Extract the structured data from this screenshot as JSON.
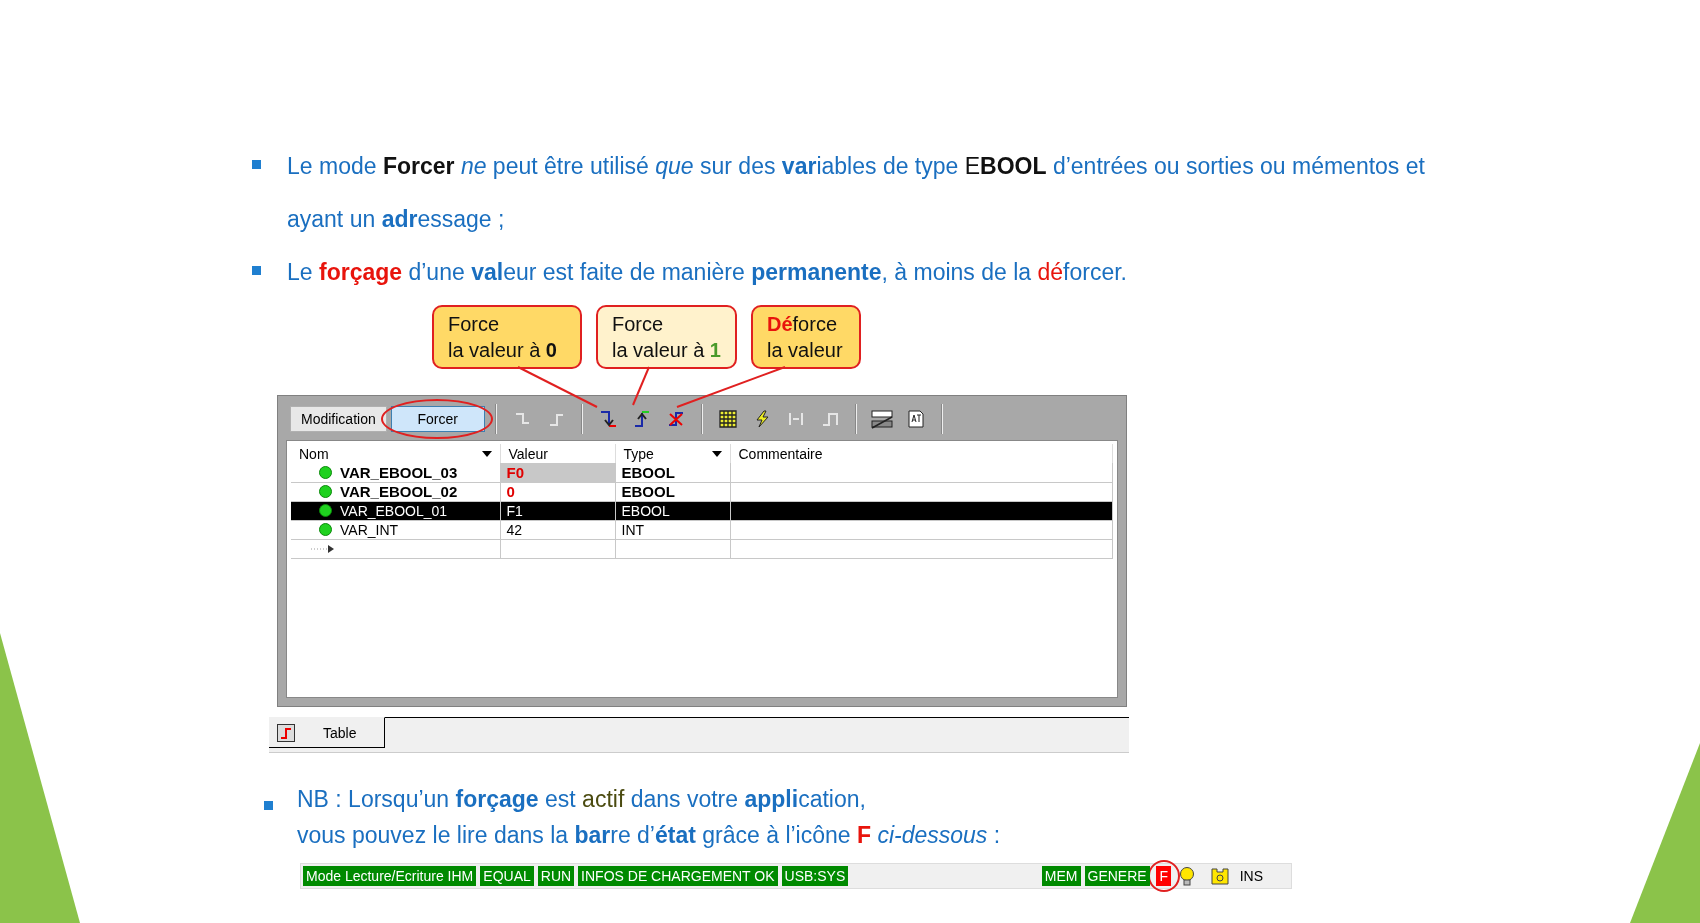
{
  "bullets": [
    {
      "lines": [
        [
          {
            "t": "Le mode "
          },
          {
            "t": "Forcer",
            "bold": true,
            "color": "#111111"
          },
          {
            "t": " ne",
            "italic": true
          },
          {
            "t": " peut être utilisé "
          },
          {
            "t": "que",
            "italic": true
          },
          {
            "t": " sur des "
          },
          {
            "t": "var",
            "bold": true
          },
          {
            "t": "iables de type "
          },
          {
            "t": "E",
            "color": "#111111"
          },
          {
            "t": "BOOL",
            "bold": true,
            "color": "#111111"
          },
          {
            "t": " d’entrées ou sorties ou mémentos et"
          }
        ],
        [
          {
            "t": "ayant un "
          },
          {
            "t": "adr",
            "bold": true
          },
          {
            "t": "essage ;"
          }
        ]
      ]
    },
    {
      "lines": [
        [
          {
            "t": "Le "
          },
          {
            "t": "forçage",
            "bold": true,
            "color": "#e8140c"
          },
          {
            "t": " d’une "
          },
          {
            "t": "val",
            "bold": true
          },
          {
            "t": "eur est faite de manière "
          },
          {
            "t": "permanente",
            "bold": true
          },
          {
            "t": ", à moins de la "
          },
          {
            "t": "dé",
            "color": "#e8140c"
          },
          {
            "t": "forcer."
          }
        ]
      ]
    }
  ],
  "callouts": [
    {
      "color": "#ffd966",
      "title": [
        {
          "t": "Force"
        }
      ],
      "line": [
        {
          "t": "la valeur à "
        },
        {
          "t": "0",
          "bold": true
        }
      ]
    },
    {
      "color": "#fff2cc",
      "title": [
        {
          "t": "Force"
        }
      ],
      "line": [
        {
          "t": "la valeur à "
        },
        {
          "t": "1",
          "bold": true,
          "color": "#4a9a2a"
        }
      ]
    },
    {
      "color": "#ffd966",
      "title": [
        {
          "t": "Dé",
          "bold": true,
          "color": "#e8140c"
        },
        {
          "t": "force"
        }
      ],
      "line": [
        {
          "t": "la valeur"
        }
      ]
    }
  ],
  "window": {
    "mode_buttons": [
      {
        "label": "Modification",
        "selected": false
      },
      {
        "label": "Forcer",
        "selected": true
      }
    ],
    "tool_groups": [
      [
        {
          "disabled": true
        },
        {
          "disabled": true
        }
      ],
      [
        {
          "disabled": false
        },
        {
          "disabled": false
        },
        {
          "disabled": false
        }
      ],
      [
        {
          "disabled": false
        },
        {
          "disabled": false
        },
        {
          "disabled": true
        },
        {
          "disabled": true
        }
      ],
      [
        {
          "disabled": false
        },
        {
          "disabled": false
        }
      ]
    ],
    "table": {
      "columns": [
        {
          "label": "Nom",
          "dropdown": true
        },
        {
          "label": "Valeur",
          "dropdown": false
        },
        {
          "label": "Type",
          "dropdown": true
        },
        {
          "label": "Commentaire",
          "dropdown": false
        }
      ],
      "rows": [
        {
          "name": "VAR_EBOOL_03",
          "value": "F0",
          "type": "EBOOL",
          "bold": true,
          "forced": true,
          "editing": true,
          "selected": false
        },
        {
          "name": "VAR_EBOOL_02",
          "value": "0",
          "type": "EBOOL",
          "bold": true,
          "forced": true,
          "editing": false,
          "selected": false
        },
        {
          "name": "VAR_EBOOL_01",
          "value": "F1",
          "type": "EBOOL",
          "bold": false,
          "forced": true,
          "editing": false,
          "selected": true
        },
        {
          "name": "VAR_INT",
          "value": "42",
          "type": "INT",
          "bold": false,
          "forced": false,
          "editing": false,
          "selected": false
        }
      ]
    },
    "tabs": [
      {
        "label": "Table",
        "selected": true
      }
    ]
  },
  "note": {
    "lines": [
      [
        {
          "t": "NB : Lorsqu’un "
        },
        {
          "t": "forçage",
          "bold": true
        },
        {
          "t": " est "
        },
        {
          "t": "actif",
          "color": "#4b4b10"
        },
        {
          "t": " dans votre "
        },
        {
          "t": "appli",
          "bold": true
        },
        {
          "t": "cation,"
        }
      ],
      [
        {
          "t": "vous pouvez le lire dans la "
        },
        {
          "t": "bar",
          "bold": true
        },
        {
          "t": "re d’"
        },
        {
          "t": "état",
          "bold": true
        },
        {
          "t": " grâce à l’icône "
        },
        {
          "t": "F",
          "bold": true,
          "color": "#e8140c"
        },
        {
          "t": " ci-dessous",
          "italic": true
        },
        {
          "t": " :"
        }
      ]
    ]
  },
  "status_bar": {
    "left": [
      {
        "kind": "text",
        "label": "Mode Lecture/Ecriture IHM",
        "color": "#008a00"
      },
      {
        "kind": "text",
        "label": "EQUAL",
        "color": "#008a00"
      },
      {
        "kind": "text",
        "label": "RUN",
        "color": "#008a00"
      },
      {
        "kind": "text",
        "label": "INFOS DE CHARGEMENT OK",
        "color": "#008a00"
      },
      {
        "kind": "text",
        "label": "USB:SYS",
        "color": "#008a00"
      }
    ],
    "right": [
      {
        "kind": "text",
        "label": "MEM",
        "color": "#008a00"
      },
      {
        "kind": "text",
        "label": "GENERE",
        "color": "#008a00"
      },
      {
        "kind": "text",
        "label": "F",
        "color": "#ff0000",
        "circled": true
      },
      {
        "kind": "bulb"
      },
      {
        "kind": "tag"
      },
      {
        "kind": "plain",
        "label": "INS"
      }
    ]
  }
}
